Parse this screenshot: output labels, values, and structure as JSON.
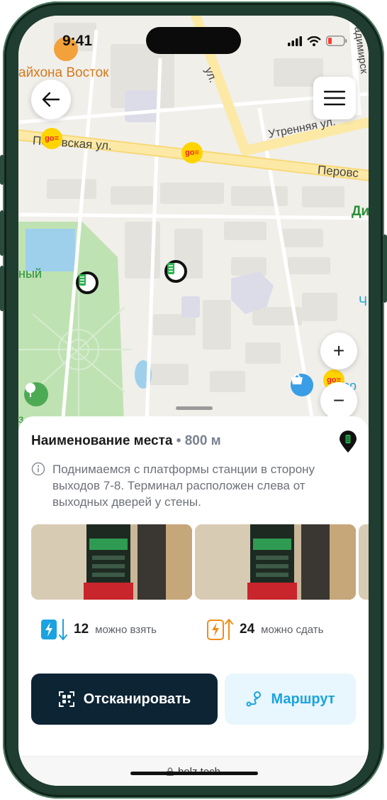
{
  "status_bar": {
    "time": "9:41"
  },
  "map": {
    "labels": {
      "cafe": "айхона Восток",
      "street_perovskaya_left": "Перовская ул.",
      "street_perovskaya_right": "Перовс",
      "street_utrennyaya": "Утренняя ул.",
      "street_vertical": "ул.",
      "street_top_right": "адимирск",
      "park_left": "ный",
      "district_right": "Ди",
      "right_edge_ch": "Ч",
      "shop_right": "Перо",
      "bottom_left": "з"
    },
    "go_badge": "go≡"
  },
  "controls": {
    "back": "back",
    "menu": "menu",
    "zoom_in": "+",
    "zoom_out": "−"
  },
  "place": {
    "name": "Наименование места",
    "separator": "•",
    "distance": "800 м",
    "description": "Поднимаемся с платформы станции в сторону выходов 7-8. Терминал расположен слева от выходных дверей у стены."
  },
  "counts": {
    "take": {
      "value": "12",
      "label": "можно взять"
    },
    "give": {
      "value": "24",
      "label": "можно сдать"
    }
  },
  "actions": {
    "scan_label": "Отсканировать",
    "route_label": "Маршрут"
  },
  "browser": {
    "url": "bolz.tech"
  },
  "colors": {
    "primary_dark": "#0d2434",
    "accent_blue": "#1aa3e0",
    "accent_orange": "#f08c1a",
    "charge_green": "#28b14c",
    "go_yellow": "#ffd400"
  },
  "icons": {
    "back": "arrow-left-icon",
    "menu": "hamburger-menu-icon",
    "pin": "station-pin-icon",
    "info": "info-icon",
    "take": "bolt-down-icon",
    "give": "bolt-up-icon",
    "scan": "qr-scan-icon",
    "route": "route-icon",
    "lock": "lock-icon"
  }
}
